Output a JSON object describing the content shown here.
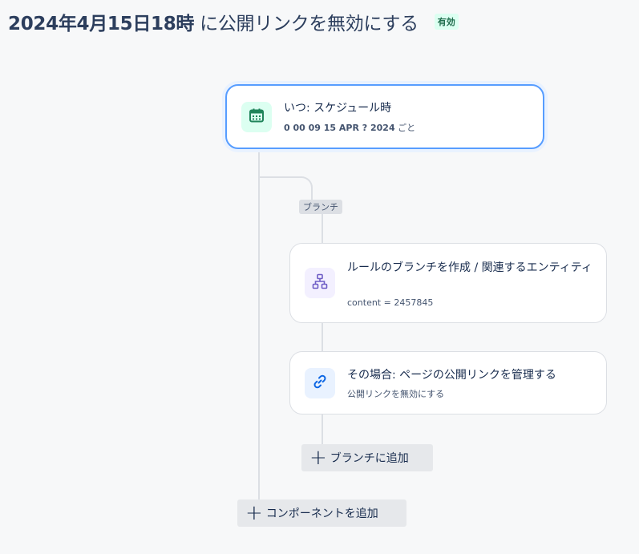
{
  "header": {
    "date_part": "2024年4月15日18時",
    "rest_part": " に公開リンクを無効にする",
    "status_badge": "有効"
  },
  "trigger": {
    "icon": "calendar-icon",
    "title": "いつ: スケジュール時",
    "subtitle": "0 00 09 15 APR ? 2024",
    "subtitle_suffix": " ごと"
  },
  "branch_label": "ブランチ",
  "branch_rule": {
    "icon": "hierarchy-icon",
    "title": "ルールのブランチを作成 / 関連するエンティティ",
    "subtitle": "content = 2457845"
  },
  "action": {
    "icon": "link-icon",
    "title": "その場合: ページの公開リンクを管理する",
    "subtitle": "公開リンクを無効にする"
  },
  "add_to_branch": "ブランチに追加",
  "add_component": "コンポーネントを追加",
  "colors": {
    "accent": "#579dff",
    "calendar_bg": "#dcfff1",
    "calendar_fg": "#1f845a",
    "hierarchy_bg": "#f3f0ff",
    "hierarchy_fg": "#6e5dc6",
    "link_bg": "#e9f2ff",
    "link_fg": "#0c66e4"
  }
}
